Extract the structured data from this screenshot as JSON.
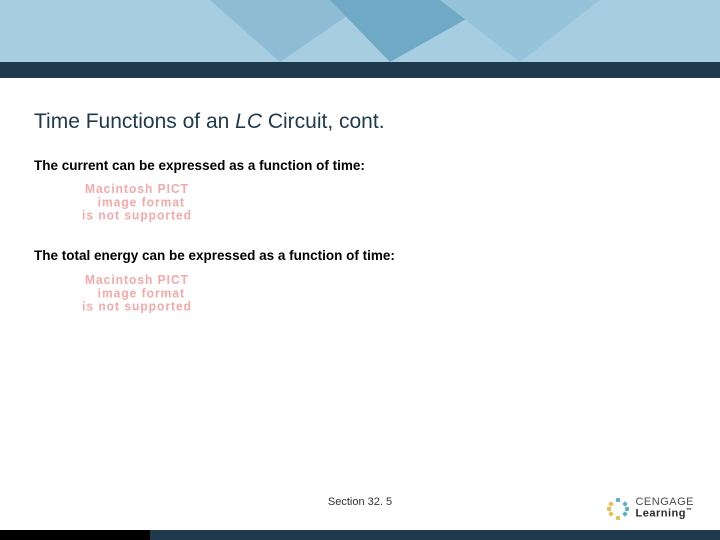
{
  "title": {
    "pre": "Time Functions of an ",
    "ital": "LC",
    "post": " Circuit, cont."
  },
  "body": {
    "line1": "The current can be expressed as a function of time:",
    "line2": "The total energy can be expressed as a function of time:"
  },
  "pict_placeholder": "Macintosh PICT\n  image format\nis not supported",
  "footer": {
    "section": "Section  32. 5"
  },
  "logo": {
    "top": "CENGAGE",
    "bottom": "Learning",
    "tm": "™"
  }
}
